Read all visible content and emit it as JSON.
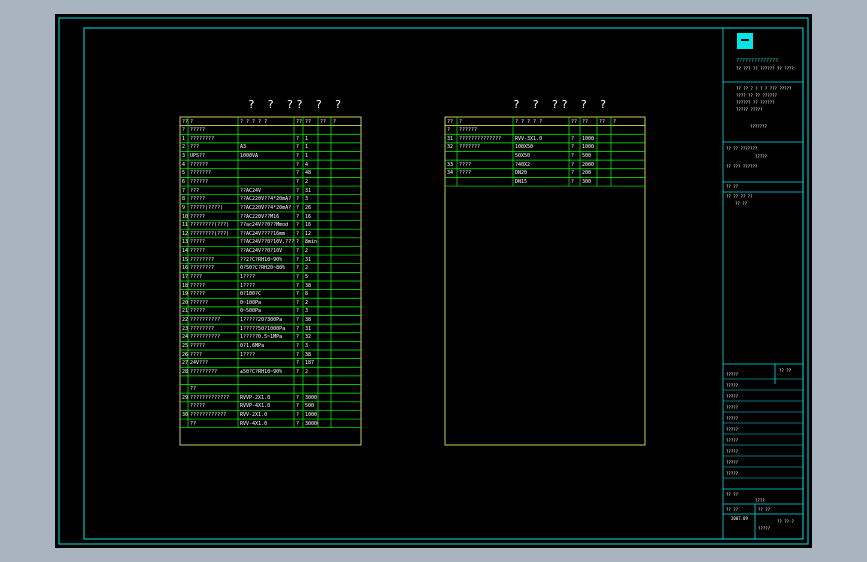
{
  "left_table": {
    "title": "? ? ?? ? ?",
    "headers": [
      "??",
      "?",
      "? ? ? ? ?",
      "??",
      "??",
      "??",
      "?"
    ],
    "rows": [
      [
        "?",
        "?????",
        "",
        "",
        "",
        "",
        ""
      ],
      [
        "1",
        "????????",
        "",
        "?",
        "1",
        "",
        ""
      ],
      [
        "2",
        "???",
        "A3",
        "?",
        "1",
        "",
        ""
      ],
      [
        "3",
        "UPS??",
        "1000VA",
        "?",
        "1",
        "",
        ""
      ],
      [
        "4",
        "??????",
        "",
        "?",
        "4",
        "",
        ""
      ],
      [
        "5",
        "???????",
        "",
        "?",
        "48",
        "",
        ""
      ],
      [
        "6",
        "??????",
        "",
        "?",
        "2",
        "",
        ""
      ],
      [
        "7",
        "???",
        "??AC24V",
        "?",
        "31",
        "",
        ""
      ],
      [
        "8",
        "?????",
        "??AC220V??4*20mA?",
        "?",
        "3",
        "",
        ""
      ],
      [
        "9",
        "?????(????)",
        "??AC220V??4*20mA?",
        "?",
        "26",
        "",
        ""
      ],
      [
        "10",
        "?????",
        "??AC220V??M16",
        "?",
        "16",
        "",
        ""
      ],
      [
        "11",
        "????????(???)",
        "??ac24V??0??Mmod",
        "?",
        "16",
        "",
        ""
      ],
      [
        "12",
        "????????(???)",
        "??AC24V????16mm",
        "?",
        "12",
        "",
        ""
      ],
      [
        "13",
        "?????",
        "??AC24V??0?10V,???",
        "?",
        "8min",
        "",
        ""
      ],
      [
        "14",
        "?????",
        "??AC24V??0?10V",
        "?",
        "2",
        "",
        ""
      ],
      [
        "15",
        "????????",
        "??2?C?RH10~90%",
        "?",
        "31",
        "",
        ""
      ],
      [
        "16",
        "????????",
        "0?50?C?RH20~80%",
        "?",
        "2",
        "",
        ""
      ],
      [
        "17",
        "????",
        "1????",
        "?",
        "5",
        "",
        ""
      ],
      [
        "18",
        "?????",
        "1????",
        "?",
        "38",
        "",
        ""
      ],
      [
        "19",
        "?????",
        "0?100?C",
        "?",
        "8",
        "",
        ""
      ],
      [
        "20",
        "??????",
        "0~100Pa",
        "?",
        "2",
        "",
        ""
      ],
      [
        "21",
        "?????",
        "0~500Pa",
        "?",
        "3",
        "",
        ""
      ],
      [
        "22",
        "??????????",
        "1?????20?300Pa",
        "?",
        "38",
        "",
        ""
      ],
      [
        "23",
        "????????",
        "1?????50?1000Pa",
        "?",
        "31",
        "",
        ""
      ],
      [
        "24",
        "??????????",
        "1?????0.5~1MPa",
        "?",
        "32",
        "",
        ""
      ],
      [
        "25",
        "?????",
        "0?1.6MPa",
        "?",
        "3",
        "",
        ""
      ],
      [
        "26",
        "????",
        "1????",
        "?",
        "38",
        "",
        ""
      ],
      [
        "27",
        "24V???",
        "",
        "?",
        "187",
        "",
        ""
      ],
      [
        "28",
        "?????????",
        "±50?C?RH10~90%",
        "?",
        "2",
        "",
        ""
      ],
      [
        "",
        "",
        "",
        "",
        "",
        "",
        ""
      ],
      [
        "",
        "??",
        "",
        "",
        "",
        "",
        ""
      ],
      [
        "29",
        "?????????????",
        "RVVP-2X1.0",
        "?",
        "3000",
        "",
        ""
      ],
      [
        "",
        "?????",
        "RVVP-4X1.0",
        "?",
        "500",
        "",
        ""
      ],
      [
        "30",
        "????????????",
        "RVV-2X1.0",
        "?",
        "1000",
        "",
        ""
      ],
      [
        "",
        "??",
        "RVV-4X1.0",
        "?",
        "30000",
        "",
        ""
      ]
    ]
  },
  "right_table": {
    "title": "? ? ?? ? ?",
    "headers": [
      "??",
      "?",
      "? ? ? ? ?",
      "??",
      "??",
      "??",
      "?"
    ],
    "rows": [
      [
        "?",
        "??????",
        "",
        "",
        "",
        "",
        ""
      ],
      [
        "31",
        "??????????????",
        "RVV-3X1.0",
        "?",
        "1000",
        "",
        ""
      ],
      [
        "32",
        "???????",
        "100X50",
        "?",
        "1000",
        "",
        ""
      ],
      [
        "",
        "",
        "50X50",
        "?",
        "500",
        "",
        ""
      ],
      [
        "33",
        "????",
        "?40X2",
        "?",
        "2000",
        "",
        ""
      ],
      [
        "34",
        "????",
        "DN20",
        "?",
        "200",
        "",
        ""
      ],
      [
        "",
        "",
        "DN15",
        "?",
        "300",
        "",
        ""
      ]
    ]
  },
  "title_block": {
    "company_line1": "??????????????",
    "company_line2": "?? ??? ?? ?????? ?? ????",
    "cert_lines": [
      "?? ?? ? ? ? ? ??? ?????",
      "???? ?? ?? ??????",
      "?????? ?? ??????",
      "????? ?????",
      "???????"
    ],
    "project_label": "?? ?? ???????",
    "project_value": "?????",
    "client_label": "?? ??? ??????",
    "design_label": "?? ??",
    "stage_label": "?? ?? ?? ??",
    "stage_value": "?? ??",
    "sheet_label": "?? ??",
    "rows": [
      "?????",
      "?????",
      "?????",
      "?????",
      "?????",
      "?????",
      "?????",
      "?????",
      "?????",
      "?????"
    ],
    "drawing_no_label": "?? ??",
    "drawing_no_value": "????",
    "date_label": "?? ??",
    "date_value": "2007.09",
    "scale_label": "?? ??",
    "scale_value": "?????",
    "sheet_no_value": "?? ??-?"
  },
  "colors": {
    "border": "#00e5e5",
    "table": "#ffff66",
    "grid": "#00ff00",
    "text": "#ffffff",
    "logo": "#00e5e5"
  }
}
